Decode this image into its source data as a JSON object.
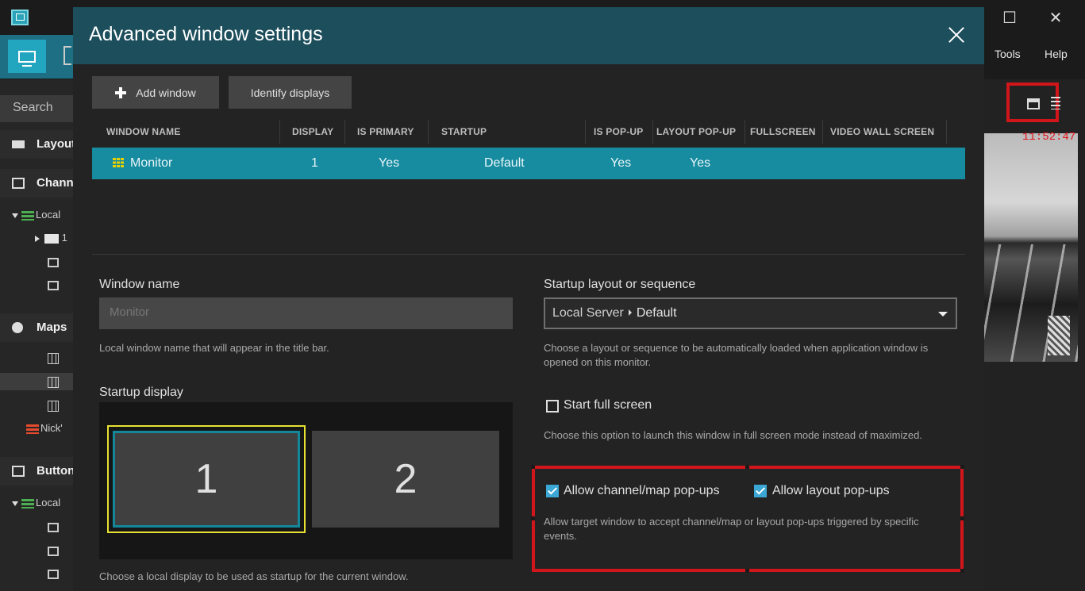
{
  "app": {
    "menu": {
      "tools": "Tools",
      "help": "Help"
    },
    "window_controls": {
      "maximize": "☐",
      "close": "✕"
    },
    "sidebar": {
      "search": "Search",
      "sections": [
        {
          "label": "Layouts"
        },
        {
          "label": "Channels"
        },
        {
          "label": "Maps"
        },
        {
          "label": "Buttons"
        }
      ],
      "channel_tree": {
        "server": "Local",
        "folder": "1"
      },
      "map_items": {
        "other_server": "Nick'"
      },
      "button_tree": {
        "server": "Local"
      }
    },
    "right_panel": {
      "time": "11:52:47"
    }
  },
  "dialog": {
    "title": "Advanced window settings",
    "toolbar": {
      "add_window": "Add window",
      "identify_displays": "Identify displays"
    },
    "table": {
      "columns": [
        "WINDOW NAME",
        "DISPLAY",
        "IS PRIMARY",
        "STARTUP",
        "IS POP-UP",
        "LAYOUT POP-UP",
        "FULLSCREEN",
        "VIDEO WALL SCREEN"
      ],
      "rows": [
        {
          "name": "Monitor",
          "display": "1",
          "is_primary": "Yes",
          "startup": "Default",
          "is_popup": "Yes",
          "layout_popup": "Yes",
          "fullscreen": "",
          "video_wall": ""
        }
      ]
    },
    "window_name": {
      "label": "Window name",
      "placeholder": "Monitor",
      "hint": "Local window name that will appear in the title bar."
    },
    "startup_display": {
      "label": "Startup display",
      "displays": [
        "1",
        "2"
      ],
      "selected": "1",
      "hint": "Choose a local display to be used as startup for the current window."
    },
    "startup_layout": {
      "label": "Startup layout or sequence",
      "server": "Local Server",
      "value": "Default",
      "hint": "Choose a layout or sequence to be automatically loaded when application window is opened on this monitor."
    },
    "full_screen": {
      "label": "Start full screen",
      "checked": false,
      "hint": "Choose this option to launch this window in full screen mode instead of maximized."
    },
    "popups": {
      "channel_map_label": "Allow channel/map pop-ups",
      "channel_map_checked": true,
      "layout_label": "Allow layout pop-ups",
      "layout_checked": true,
      "hint": "Allow target window to accept channel/map or layout pop-ups triggered by specific events."
    }
  },
  "colors": {
    "header": "#1d4e5c",
    "selected_row": "#178ba0",
    "checkbox": "#3aa7d4",
    "highlight": "#d0151b",
    "primary_display_outline": "#e8e132"
  }
}
